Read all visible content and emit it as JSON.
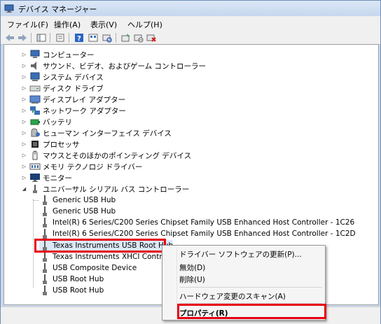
{
  "window": {
    "title": "デバイス マネージャー"
  },
  "menu": [
    {
      "label": "ファイル(F)"
    },
    {
      "label": "操作(A)"
    },
    {
      "label": "表示(V)"
    },
    {
      "label": "ヘルプ(H)"
    }
  ],
  "toolbar": {
    "icons": [
      "back-arrow-icon",
      "forward-arrow-icon",
      "console-tree-icon",
      "properties-icon",
      "help-icon",
      "view-icon",
      "scan-hardware-icon",
      "update-driver-icon",
      "disable-device-icon",
      "uninstall-device-icon"
    ]
  },
  "tree": {
    "categories": [
      {
        "label": "コンピューター",
        "icon": "computer-icon"
      },
      {
        "label": "サウンド、ビデオ、およびゲーム コントローラー",
        "icon": "speaker-icon"
      },
      {
        "label": "システム デバイス",
        "icon": "system-device-icon"
      },
      {
        "label": "ディスク ドライブ",
        "icon": "disk-drive-icon"
      },
      {
        "label": "ディスプレイ アダプター",
        "icon": "display-adapter-icon"
      },
      {
        "label": "ネットワーク アダプター",
        "icon": "network-adapter-icon"
      },
      {
        "label": "バッテリ",
        "icon": "battery-icon"
      },
      {
        "label": "ヒューマン インターフェイス デバイス",
        "icon": "hid-icon"
      },
      {
        "label": "プロセッサ",
        "icon": "processor-icon"
      },
      {
        "label": "マウスとそのほかのポインティング デバイス",
        "icon": "mouse-icon"
      },
      {
        "label": "メモリ テクノロジ ドライバー",
        "icon": "memory-icon"
      },
      {
        "label": "モニター",
        "icon": "monitor-icon"
      },
      {
        "label": "ユニバーサル シリアル バス コントローラー",
        "icon": "usb-controller-icon"
      }
    ],
    "usb_children": [
      {
        "label": "Generic USB Hub"
      },
      {
        "label": "Generic USB Hub"
      },
      {
        "label": "Intel(R) 6 Series/C200 Series Chipset Family USB Enhanced Host Controller - 1C26"
      },
      {
        "label": "Intel(R) 6 Series/C200 Series Chipset Family USB Enhanced Host Controller - 1C2D"
      },
      {
        "label": "Texas Instruments USB Root Hub"
      },
      {
        "label": "Texas Instruments XHCI Controller"
      },
      {
        "label": "USB Composite Device"
      },
      {
        "label": "USB Root Hub"
      },
      {
        "label": "USB Root Hub"
      }
    ]
  },
  "context_menu": {
    "update_driver": "ドライバー ソフトウェアの更新(P)...",
    "disable": "無効(D)",
    "uninstall": "削除(U)",
    "scan": "ハードウェア変更のスキャン(A)",
    "properties": "プロパティ(R)"
  },
  "colors": {
    "highlight": "#e60012"
  }
}
